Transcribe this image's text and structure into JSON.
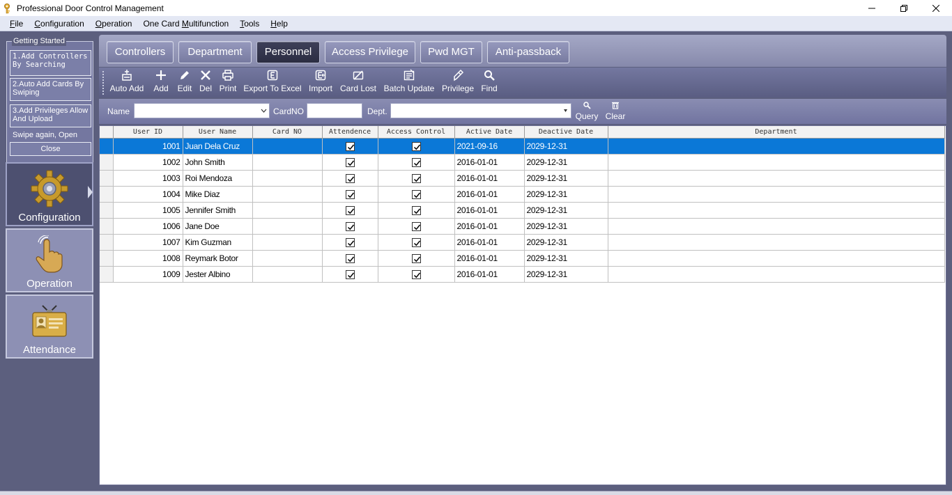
{
  "window": {
    "title": "Professional Door Control Management"
  },
  "menu": [
    {
      "label": "File",
      "underline": "F"
    },
    {
      "label": "Configuration",
      "underline": "C"
    },
    {
      "label": "Operation",
      "underline": "O"
    },
    {
      "label": "One Card Multifunction",
      "underline": "M"
    },
    {
      "label": "Tools",
      "underline": "T"
    },
    {
      "label": "Help",
      "underline": "H"
    }
  ],
  "getting_started": {
    "legend": "Getting Started",
    "step1": "1.Add Controllers By Searching",
    "step2": "2.Auto Add Cards By Swiping",
    "step3": "3.Add Privileges Allow And Upload",
    "swipe": "Swipe again, Open",
    "close": "Close"
  },
  "nav": {
    "configuration": "Configuration",
    "operation": "Operation",
    "attendance": "Attendance"
  },
  "tabs": [
    "Controllers",
    "Department",
    "Personnel",
    "Access Privilege",
    "Pwd MGT",
    "Anti-passback"
  ],
  "active_tab": "Personnel",
  "toolbar": {
    "auto_add": "Auto Add",
    "add": "Add",
    "edit": "Edit",
    "del": "Del",
    "print": "Print",
    "export": "Export To Excel",
    "import": "Import",
    "card_lost": "Card Lost",
    "batch_update": "Batch Update",
    "privilege": "Privilege",
    "find": "Find"
  },
  "filter": {
    "name_label": "Name",
    "name_value": "",
    "cardno_label": "CardNO",
    "cardno_value": "",
    "dept_label": "Dept.",
    "dept_value": "",
    "query": "Query",
    "clear": "Clear"
  },
  "grid": {
    "columns": [
      "User ID",
      "User Name",
      "Card NO",
      "Attendence",
      "Access Control",
      "Active Date",
      "Deactive Date",
      "Department"
    ],
    "rows": [
      {
        "id": "1001",
        "name": "Juan  Dela Cruz",
        "card": "",
        "attendance": true,
        "access": true,
        "active": "2021-09-16",
        "deactive": "2029-12-31",
        "dept": ""
      },
      {
        "id": "1002",
        "name": "John Smith",
        "card": "",
        "attendance": true,
        "access": true,
        "active": "2016-01-01",
        "deactive": "2029-12-31",
        "dept": ""
      },
      {
        "id": "1003",
        "name": "Roi  Mendoza",
        "card": "",
        "attendance": true,
        "access": true,
        "active": "2016-01-01",
        "deactive": "2029-12-31",
        "dept": ""
      },
      {
        "id": "1004",
        "name": "Mike Diaz",
        "card": "",
        "attendance": true,
        "access": true,
        "active": "2016-01-01",
        "deactive": "2029-12-31",
        "dept": ""
      },
      {
        "id": "1005",
        "name": "Jennifer Smith",
        "card": "",
        "attendance": true,
        "access": true,
        "active": "2016-01-01",
        "deactive": "2029-12-31",
        "dept": ""
      },
      {
        "id": "1006",
        "name": "Jane Doe",
        "card": "",
        "attendance": true,
        "access": true,
        "active": "2016-01-01",
        "deactive": "2029-12-31",
        "dept": ""
      },
      {
        "id": "1007",
        "name": "Kim Guzman",
        "card": "",
        "attendance": true,
        "access": true,
        "active": "2016-01-01",
        "deactive": "2029-12-31",
        "dept": ""
      },
      {
        "id": "1008",
        "name": "Reymark Botor",
        "card": "",
        "attendance": true,
        "access": true,
        "active": "2016-01-01",
        "deactive": "2029-12-31",
        "dept": ""
      },
      {
        "id": "1009",
        "name": "Jester Albino",
        "card": "",
        "attendance": true,
        "access": true,
        "active": "2016-01-01",
        "deactive": "2029-12-31",
        "dept": ""
      }
    ],
    "selected_row": 0
  },
  "colors": {
    "selection": "#0b78d7",
    "sidebar_bg": "#5c5f7e",
    "active_tab": "#2b2d42"
  }
}
